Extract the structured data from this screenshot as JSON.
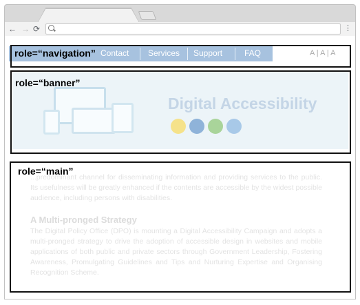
{
  "browser": {
    "tab_title": "",
    "new_tab": "",
    "back": "←",
    "forward": "→",
    "reload": "⟳",
    "address_value": "",
    "menu": "⋮"
  },
  "site": {
    "nav_links": [
      {
        "label": "Contact"
      },
      {
        "label": "Services"
      },
      {
        "label": "Support"
      },
      {
        "label": "FAQ"
      }
    ],
    "font_size_control": "A | A | A",
    "banner_title": "Digital Accessibility",
    "banner_icons": [
      "eye-icon",
      "sign-language-icon",
      "phone-icon",
      "location-icon"
    ],
    "intro_text": "...predominant channel for disseminating information and providing services to the public. Its usefulness will be greatly enhanced if the contents are accessible by the widest possible audience, including persons with disabilities.",
    "section_heading": "A Multi-pronged Strategy",
    "section_text": "The Digital Policy Office (DPO) is mounting a Digital Accessibility Campaign and adopts a multi-pronged strategy to drive the adoption of accessible design in websites and mobile applications of both public and private sectors through Government Leadership, Fostering Awareness, Promulgating Guidelines and Tips and Nurturing Expertise and Organising Recognition Scheme."
  },
  "annotations": {
    "navigation": "role=“navigation”",
    "banner": "role=“banner”",
    "main": "role=“main”"
  },
  "colors": {
    "nav_bar": "#a7c2df",
    "banner_bg": "#ecf4f8",
    "annotation_border": "#111111",
    "icon_colors": [
      "#f5e28a",
      "#8fb3d9",
      "#a9d49a",
      "#a8c9e8"
    ]
  }
}
